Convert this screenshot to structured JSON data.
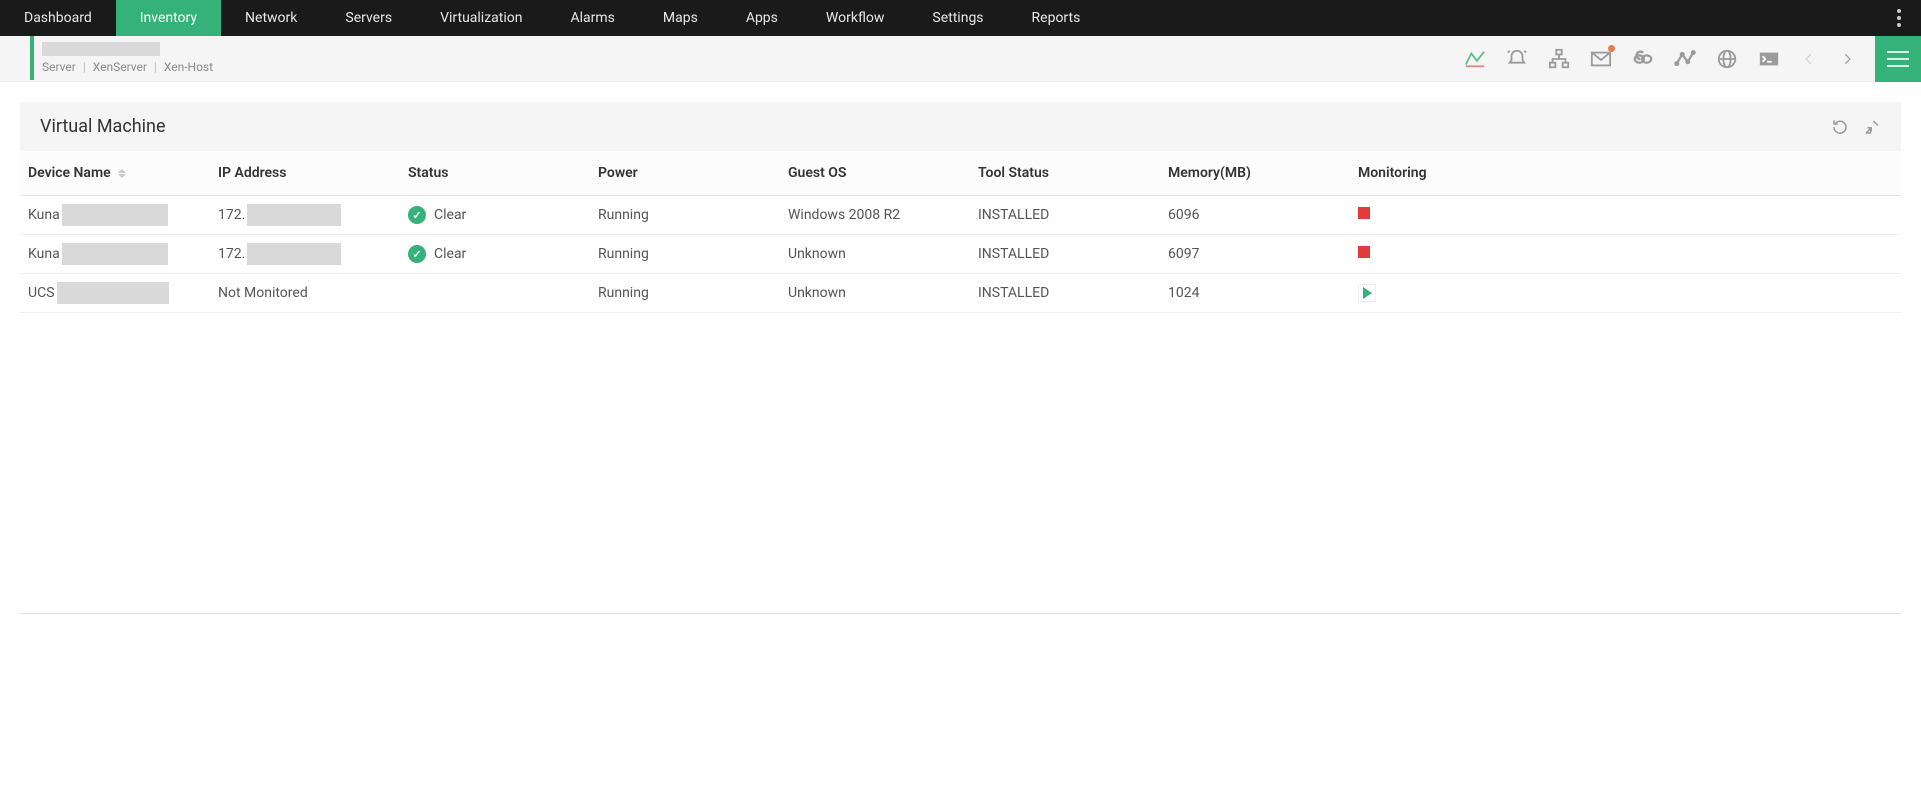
{
  "nav": {
    "items": [
      {
        "label": "Dashboard",
        "active": false
      },
      {
        "label": "Inventory",
        "active": true
      },
      {
        "label": "Network",
        "active": false
      },
      {
        "label": "Servers",
        "active": false
      },
      {
        "label": "Virtualization",
        "active": false
      },
      {
        "label": "Alarms",
        "active": false
      },
      {
        "label": "Maps",
        "active": false
      },
      {
        "label": "Apps",
        "active": false
      },
      {
        "label": "Workflow",
        "active": false
      },
      {
        "label": "Settings",
        "active": false
      },
      {
        "label": "Reports",
        "active": false
      }
    ]
  },
  "breadcrumb": {
    "seg0": "Server",
    "seg1": "XenServer",
    "seg2": "Xen-Host",
    "separator": "|"
  },
  "panel": {
    "title": "Virtual Machine"
  },
  "table": {
    "headers": {
      "device": "Device Name",
      "ip": "IP Address",
      "status": "Status",
      "power": "Power",
      "os": "Guest OS",
      "tool": "Tool Status",
      "memory": "Memory(MB)",
      "monitoring": "Monitoring"
    },
    "rows": [
      {
        "deviceVisible": "Kuna",
        "deviceRedactedWidth": 106,
        "ipVisible": "172.",
        "ipRedactedWidth": 94,
        "statusIcon": "ok",
        "statusText": "Clear",
        "power": "Running",
        "os": "Windows 2008 R2",
        "tool": "INSTALLED",
        "memory": "6096",
        "monitoring": "red"
      },
      {
        "deviceVisible": "Kuna",
        "deviceRedactedWidth": 106,
        "ipVisible": "172.",
        "ipRedactedWidth": 94,
        "statusIcon": "ok",
        "statusText": "Clear",
        "power": "Running",
        "os": "Unknown",
        "tool": "INSTALLED",
        "memory": "6097",
        "monitoring": "red"
      },
      {
        "deviceVisible": "UCS",
        "deviceRedactedWidth": 112,
        "ipVisible": "Not Monitored",
        "ipRedactedWidth": 0,
        "statusIcon": "",
        "statusText": "",
        "power": "Running",
        "os": "Unknown",
        "tool": "INSTALLED",
        "memory": "1024",
        "monitoring": "play"
      }
    ]
  },
  "icons": {
    "chart": "chart-icon",
    "alert": "alert-icon",
    "topology": "topology-icon",
    "mail": "mail-icon",
    "link": "link-icon",
    "activity": "activity-icon",
    "globe": "globe-icon",
    "terminal": "terminal-icon"
  }
}
